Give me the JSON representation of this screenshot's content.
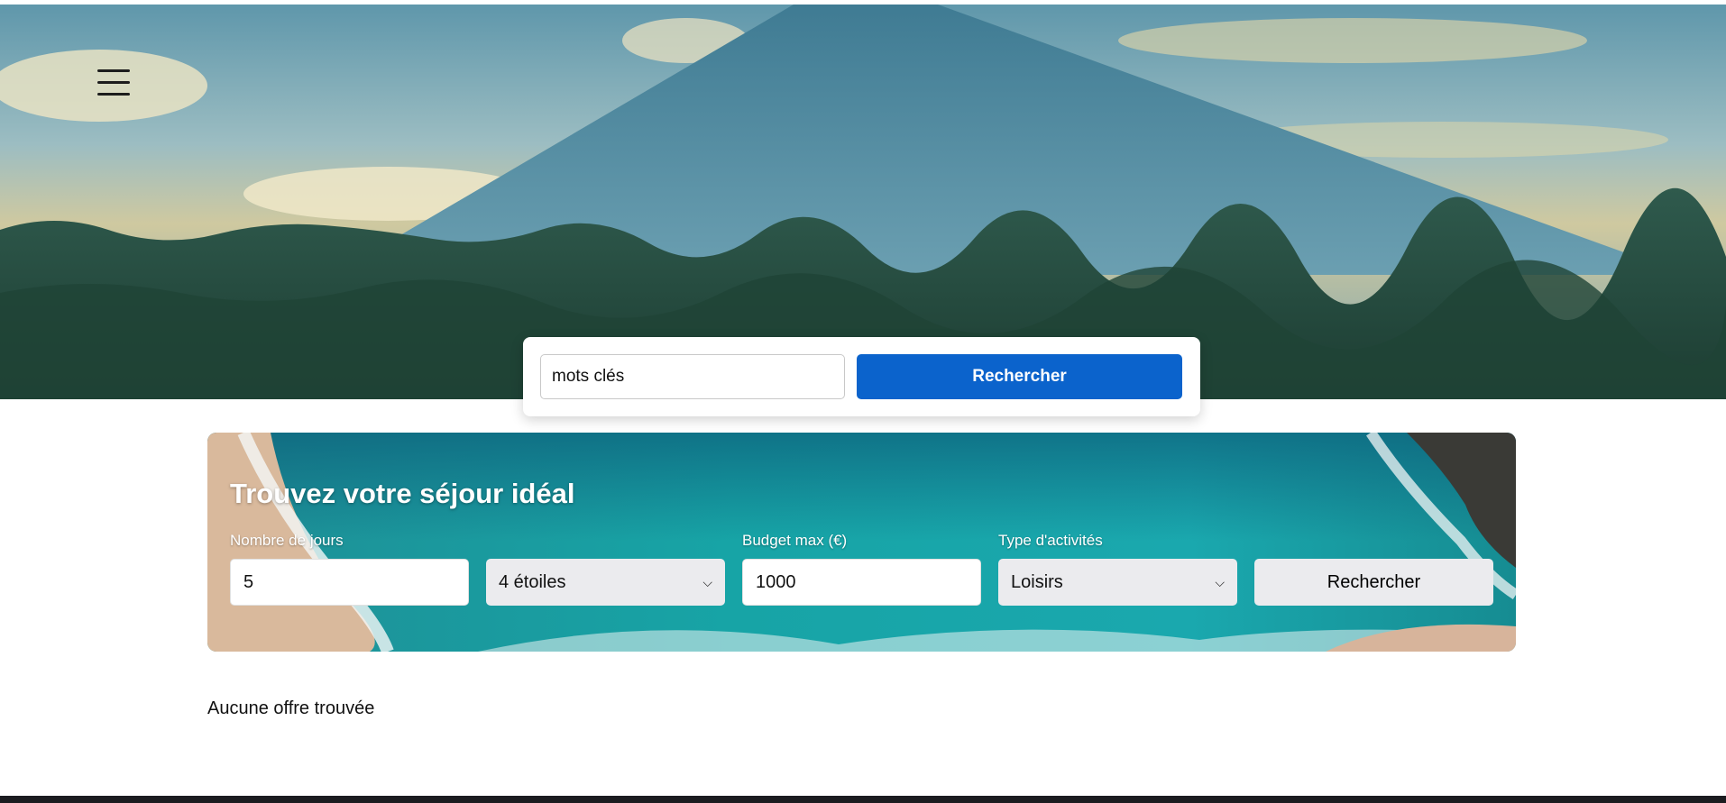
{
  "header": {
    "menu_icon": "hamburger-icon"
  },
  "keyword_search": {
    "value": "mots clés",
    "button_label": "Rechercher"
  },
  "finder": {
    "title": "Trouvez votre séjour idéal",
    "days": {
      "label": "Nombre de jours",
      "value": "5"
    },
    "stars": {
      "selected": "4 étoiles"
    },
    "budget": {
      "label": "Budget max (€)",
      "value": "1000"
    },
    "activity": {
      "label": "Type d'activités",
      "selected": "Loisirs"
    },
    "button_label": "Rechercher"
  },
  "results": {
    "message": "Aucune offre trouvée"
  },
  "colors": {
    "primary": "#0b63cc",
    "footer": "#1b1c20"
  }
}
